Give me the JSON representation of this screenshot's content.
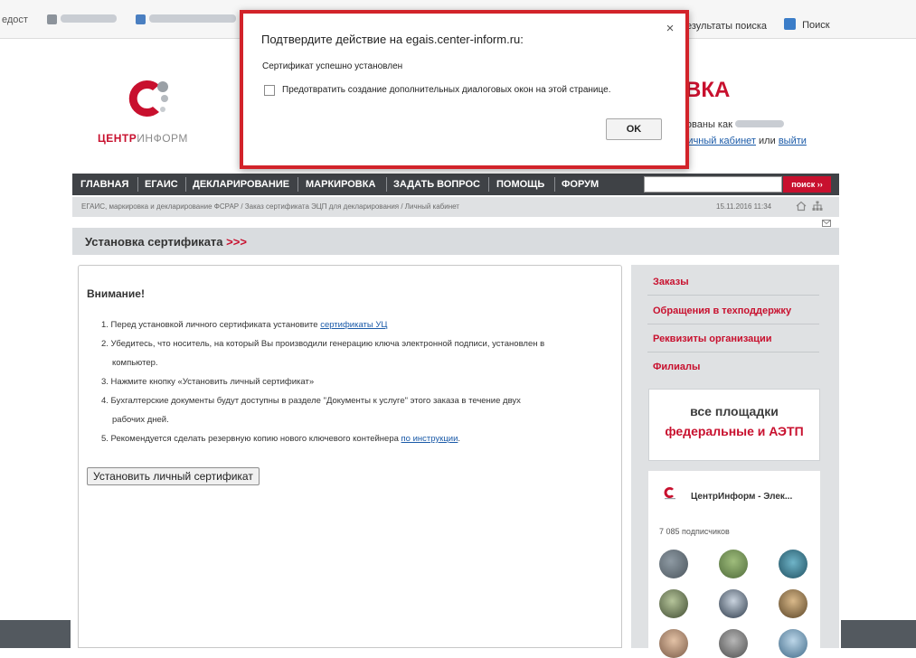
{
  "favorites": {
    "partial_left": "едост",
    "search_results": "езультаты поиска",
    "search": "Поиск"
  },
  "header": {
    "logo_red": "ЦЕНТР",
    "logo_gray": "ИНФОРМ",
    "title_fragment": "ВКА",
    "logged_as": "зованы как",
    "cabinet_link": "личный кабинет",
    "or_text": "или",
    "logout_link": "выйти"
  },
  "nav": {
    "items": [
      "ГЛАВНАЯ",
      "ЕГАИС",
      "ДЕКЛАРИРОВАНИЕ",
      "МАРКИРОВКА",
      "ЗАДАТЬ ВОПРОС",
      "ПОМОЩЬ",
      "ФОРУМ"
    ],
    "search_button": "поиск ››",
    "search_value": ""
  },
  "breadcrumb": {
    "text": "ЕГАИС, маркировка и декларирование ФСРАР / Заказ сертификата ЭЦП для декларирования / Личный кабинет",
    "datetime": "15.11.2016 11:34"
  },
  "section": {
    "title": "Установка сертификата",
    "arrows": ">>>"
  },
  "content": {
    "heading": "Внимание!",
    "step1_text": "1. Перед установкой личного сертификата установите ",
    "step1_link": "сертификаты УЦ",
    "step2": "2. Убедитесь, что носитель, на который Вы производили генерацию ключа электронной подписи, установлен в",
    "step2_cont": "компьютер.",
    "step3": "3. Нажмите кнопку «Установить личный сертификат»",
    "step4": "4. Бухгалтерские документы будут доступны в разделе \"Документы к услуге\" этого заказа в течение двух",
    "step4_cont": "рабочих дней.",
    "step5_text": "5. Рекомендуется сделать резервную копию нового ключевого контейнера ",
    "step5_link": "по инструкции",
    "step5_end": ".",
    "install_button": "Установить личный сертификат"
  },
  "sidebar": {
    "links": [
      "Заказы",
      "Обращения в техподдержку",
      "Реквизиты организации",
      "Филиалы"
    ],
    "banner_line1": "все площадки",
    "banner_line2": "федеральные и АЭТП",
    "vk_name": "ЦентрИнформ - Элек...",
    "vk_subscribers": "7 085 подписчиков"
  },
  "dialog": {
    "title": "Подтвердите действие на egais.center-inform.ru:",
    "message": "Сертификат успешно установлен",
    "checkbox_label": "Предотвратить создание дополнительных диалоговых окон на этой странице.",
    "ok_button": "OK",
    "close_glyph": "×"
  },
  "colors": {
    "accent_red": "#c8102e",
    "nav_dark": "#3f4246",
    "link_blue": "#1a5aa8",
    "dialog_highlight": "#d2232a"
  }
}
